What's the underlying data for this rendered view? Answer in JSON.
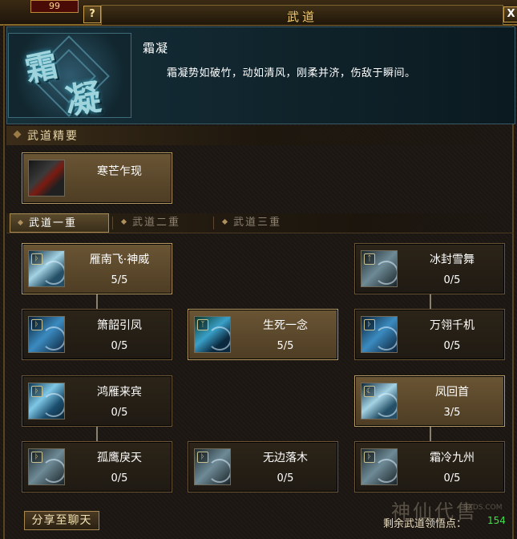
{
  "top": {
    "hp_value": "99",
    "help_label": "?",
    "close_label": "X"
  },
  "window": {
    "title": "武道"
  },
  "skill": {
    "emblem_glyphs": [
      "霜",
      "凝"
    ],
    "name": "霜凝",
    "description": "霜凝势如破竹，动如清风，刚柔并济，伤敌于瞬间。"
  },
  "essence": {
    "section_title": "武道精要",
    "item": {
      "name": "寒芒乍现",
      "icon": "blade-icon"
    }
  },
  "tabs": [
    {
      "label": "武道一重",
      "active": true
    },
    {
      "label": "武道二重",
      "active": false
    },
    {
      "label": "武道三重",
      "active": false
    }
  ],
  "skills": [
    {
      "name": "雁南飞·神威",
      "level": "5/5",
      "active": true,
      "icon": "wind-strike-icon"
    },
    {
      "name": "冰封雪舞",
      "level": "0/5",
      "active": false,
      "icon": "frost-icon"
    },
    {
      "name": "箫韶引凤",
      "level": "0/5",
      "active": false,
      "icon": "phoenix-icon"
    },
    {
      "name": "生死一念",
      "level": "5/5",
      "active": true,
      "icon": "spirit-icon"
    },
    {
      "name": "万翎千机",
      "level": "0/5",
      "active": false,
      "icon": "feather-icon"
    },
    {
      "name": "鸿雁来宾",
      "level": "0/5",
      "active": false,
      "icon": "swan-icon"
    },
    {
      "name": "凤回首",
      "level": "3/5",
      "active": true,
      "icon": "moon-icon"
    },
    {
      "name": "孤鹰戾天",
      "level": "0/5",
      "active": false,
      "icon": "eagle-icon"
    },
    {
      "name": "无边落木",
      "level": "0/5",
      "active": false,
      "icon": "leaf-icon"
    },
    {
      "name": "霜冷九州",
      "level": "0/5",
      "active": false,
      "icon": "ice-icon"
    }
  ],
  "footer": {
    "share_label": "分享至聊天",
    "points_label": "剩余武道领悟点：",
    "points_value": "154",
    "watermark": "神仙代售",
    "watermark_sub": "SXDS.COM"
  },
  "colors": {
    "accent_gold": "#e9d7a8",
    "points_green": "#3fe04a",
    "active_card": "#6a5534"
  }
}
